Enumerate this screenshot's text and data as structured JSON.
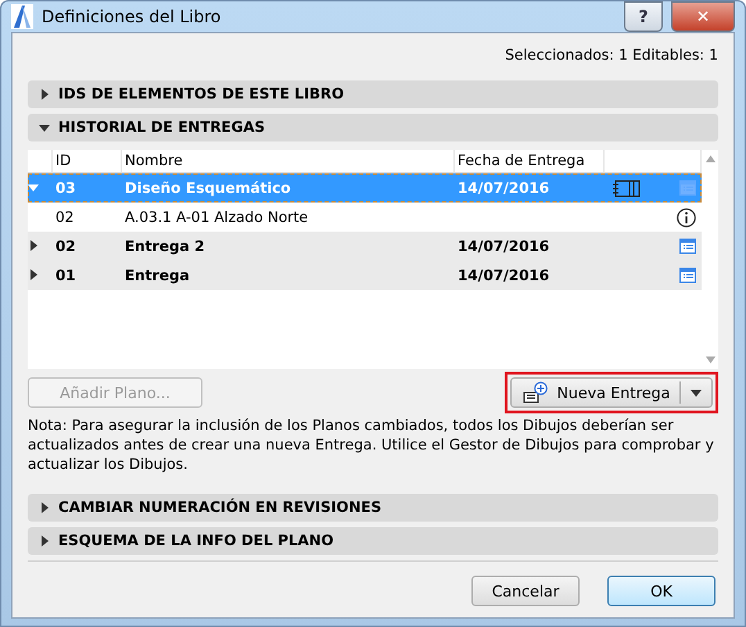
{
  "window": {
    "title": "Definiciones del Libro",
    "help": "?",
    "close": "✕"
  },
  "selection_info": "Seleccionados: 1 Editables: 1",
  "sections": [
    {
      "title": "IDS DE ELEMENTOS DE ESTE LIBRO",
      "expanded": false
    },
    {
      "title": "HISTORIAL DE ENTREGAS",
      "expanded": true
    },
    {
      "title": "CAMBIAR NUMERACIÓN EN REVISIONES",
      "expanded": false
    },
    {
      "title": "ESQUEMA DE LA INFO DEL PLANO",
      "expanded": false
    }
  ],
  "table": {
    "columns": [
      "ID",
      "Nombre",
      "Fecha de Entrega"
    ],
    "rows": [
      {
        "kind": "issue",
        "id": "03",
        "name": "Diseño Esquemático",
        "date": "14/07/2016",
        "selected": true,
        "expanded": true,
        "children": [
          {
            "kind": "sheet",
            "id": "02",
            "name": "A.03.1 A-01 Alzado Norte",
            "selected": false
          }
        ]
      },
      {
        "kind": "issue",
        "id": "02",
        "name": "Entrega 2",
        "date": "14/07/2016",
        "selected": false,
        "expanded": false
      },
      {
        "kind": "issue",
        "id": "01",
        "name": "Entrega",
        "date": "14/07/2016",
        "selected": false,
        "expanded": false
      }
    ]
  },
  "add_sheet_button": {
    "label": "Añadir Plano...",
    "disabled": true
  },
  "new_issue_button": {
    "label": "Nueva Entrega",
    "highlighted": true
  },
  "note": "Nota: Para asegurar la inclusión de los Planos cambiados, todos los Dibujos deberían ser actualizados antes de crear una nueva Entrega. Utilice el Gestor de Dibujos para comprobar y actualizar los Dibujos.",
  "buttons": [
    {
      "label": "Cancelar",
      "default": false
    },
    {
      "label": "OK",
      "default": true
    }
  ]
}
